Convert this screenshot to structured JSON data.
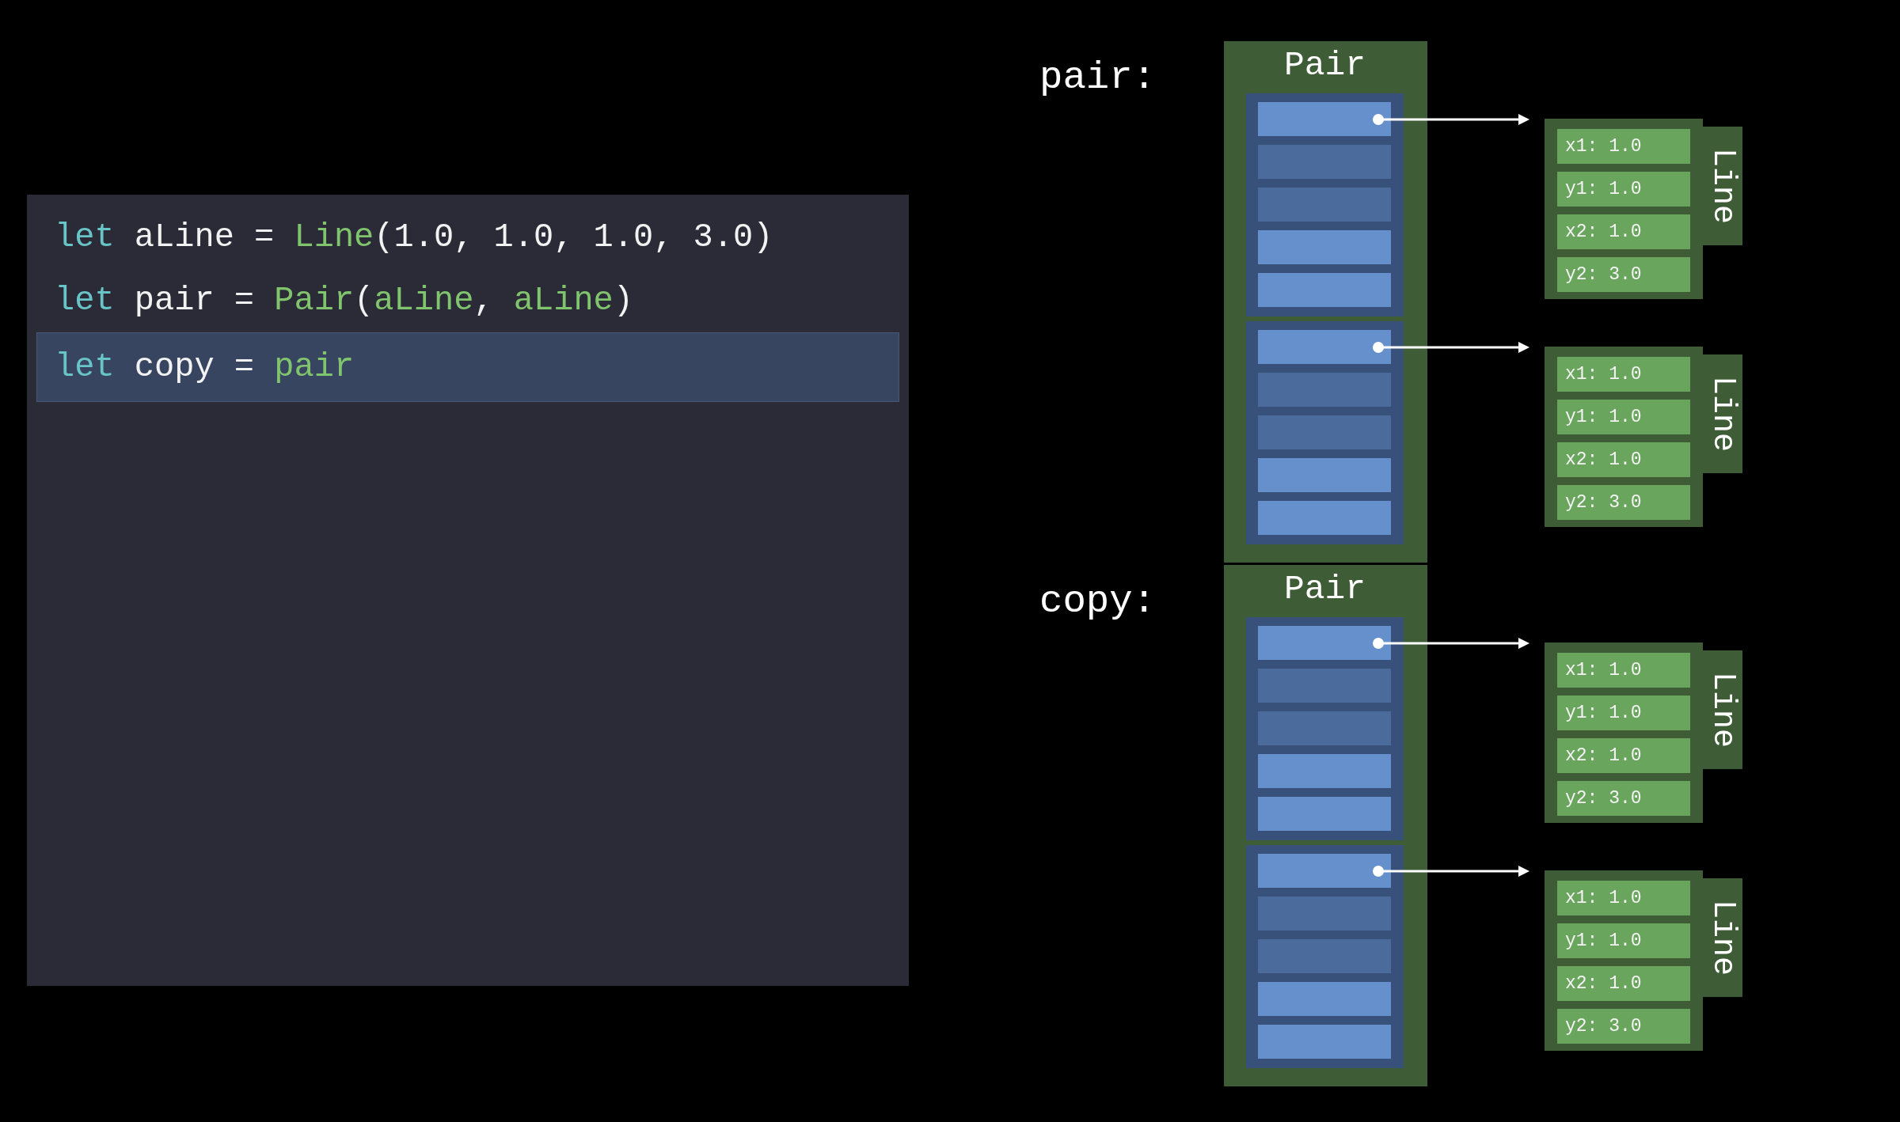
{
  "code": {
    "lines": [
      {
        "selected": false,
        "tokens": [
          {
            "kind": "keyword",
            "text": "let"
          },
          {
            "kind": "plain",
            "text": " aLine = "
          },
          {
            "kind": "name",
            "text": "Line"
          },
          {
            "kind": "plain",
            "text": "(1.0, 1.0, 1.0, 3.0)"
          }
        ]
      },
      {
        "selected": false,
        "tokens": [
          {
            "kind": "keyword",
            "text": "let"
          },
          {
            "kind": "plain",
            "text": " pair = "
          },
          {
            "kind": "name",
            "text": "Pair"
          },
          {
            "kind": "plain",
            "text": "("
          },
          {
            "kind": "name",
            "text": "aLine"
          },
          {
            "kind": "plain",
            "text": ", "
          },
          {
            "kind": "name",
            "text": "aLine"
          },
          {
            "kind": "plain",
            "text": ")"
          }
        ]
      },
      {
        "selected": true,
        "tokens": [
          {
            "kind": "keyword",
            "text": "let"
          },
          {
            "kind": "plain",
            "text": " copy = "
          },
          {
            "kind": "name",
            "text": "pair"
          }
        ]
      }
    ]
  },
  "variables": [
    {
      "label": "pair:",
      "pair": {
        "title": "Pair",
        "groups": [
          {
            "slots": [
              {
                "color": "#6590cb"
              },
              {
                "color": "#4a6b9b"
              },
              {
                "color": "#4a6b9b"
              },
              {
                "color": "#6590cb"
              },
              {
                "color": "#6590cb"
              }
            ]
          },
          {
            "slots": [
              {
                "color": "#6590cb"
              },
              {
                "color": "#4a6b9b"
              },
              {
                "color": "#4a6b9b"
              },
              {
                "color": "#6590cb"
              },
              {
                "color": "#6590cb"
              }
            ]
          }
        ]
      },
      "lines": [
        {
          "title": "Line",
          "fields": [
            "x1: 1.0",
            "y1: 1.0",
            "x2: 1.0",
            "y2: 3.0"
          ]
        },
        {
          "title": "Line",
          "fields": [
            "x1: 1.0",
            "y1: 1.0",
            "x2: 1.0",
            "y2: 3.0"
          ]
        }
      ]
    },
    {
      "label": "copy:",
      "pair": {
        "title": "Pair",
        "groups": [
          {
            "slots": [
              {
                "color": "#6590cb"
              },
              {
                "color": "#4a6b9b"
              },
              {
                "color": "#4a6b9b"
              },
              {
                "color": "#6590cb"
              },
              {
                "color": "#6590cb"
              }
            ]
          },
          {
            "slots": [
              {
                "color": "#6590cb"
              },
              {
                "color": "#4a6b9b"
              },
              {
                "color": "#4a6b9b"
              },
              {
                "color": "#6590cb"
              },
              {
                "color": "#6590cb"
              }
            ]
          }
        ]
      },
      "lines": [
        {
          "title": "Line",
          "fields": [
            "x1: 1.0",
            "y1: 1.0",
            "x2: 1.0",
            "y2: 3.0"
          ]
        },
        {
          "title": "Line",
          "fields": [
            "x1: 1.0",
            "y1: 1.0",
            "x2: 1.0",
            "y2: 3.0"
          ]
        }
      ]
    }
  ]
}
